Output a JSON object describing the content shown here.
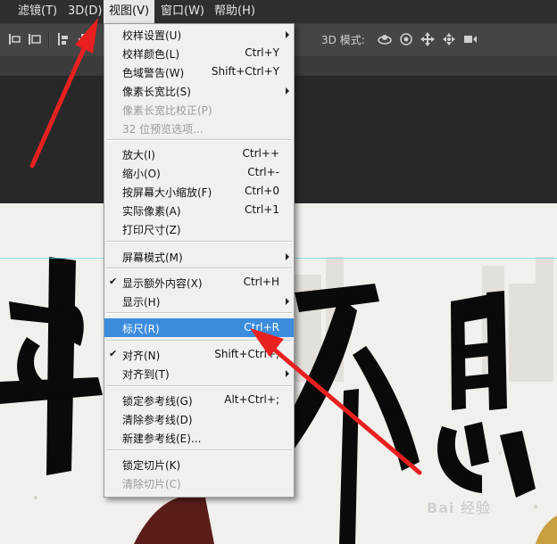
{
  "menubar": {
    "items": [
      {
        "label": "滤镜(T)"
      },
      {
        "label": "3D(D)"
      },
      {
        "label": "视图(V)"
      },
      {
        "label": "窗口(W)"
      },
      {
        "label": "帮助(H)"
      }
    ]
  },
  "toolbar": {
    "mode_3d_label": "3D 模式:",
    "icons": [
      "align-left-icon",
      "align-center-icon",
      "align-top-icon",
      "rotate-3d-icon",
      "roll-3d-icon",
      "pan-3d-icon",
      "slide-3d-icon",
      "scale-3d-icon"
    ]
  },
  "view_menu": {
    "items": [
      {
        "label": "校样设置(U)",
        "shortcut": "",
        "submenu": true,
        "disabled": false
      },
      {
        "label": "校样颜色(L)",
        "shortcut": "Ctrl+Y",
        "submenu": false,
        "disabled": false
      },
      {
        "label": "色域警告(W)",
        "shortcut": "Shift+Ctrl+Y",
        "submenu": false,
        "disabled": false
      },
      {
        "label": "像素长宽比(S)",
        "shortcut": "",
        "submenu": true,
        "disabled": false
      },
      {
        "label": "像素长宽比校正(P)",
        "shortcut": "",
        "submenu": false,
        "disabled": true
      },
      {
        "label": "32 位预览选项...",
        "shortcut": "",
        "submenu": false,
        "disabled": true
      },
      {
        "label": "放大(I)",
        "shortcut": "Ctrl++",
        "submenu": false,
        "disabled": false
      },
      {
        "label": "缩小(O)",
        "shortcut": "Ctrl+-",
        "submenu": false,
        "disabled": false
      },
      {
        "label": "按屏幕大小缩放(F)",
        "shortcut": "Ctrl+0",
        "submenu": false,
        "disabled": false
      },
      {
        "label": "实际像素(A)",
        "shortcut": "Ctrl+1",
        "submenu": false,
        "disabled": false
      },
      {
        "label": "打印尺寸(Z)",
        "shortcut": "",
        "submenu": false,
        "disabled": false
      },
      {
        "label": "屏幕模式(M)",
        "shortcut": "",
        "submenu": true,
        "disabled": false
      },
      {
        "label": "显示额外内容(X)",
        "shortcut": "Ctrl+H",
        "submenu": false,
        "disabled": false,
        "checked": true
      },
      {
        "label": "显示(H)",
        "shortcut": "",
        "submenu": true,
        "disabled": false
      },
      {
        "label": "标尺(R)",
        "shortcut": "Ctrl+R",
        "submenu": false,
        "disabled": false,
        "highlighted": true
      },
      {
        "label": "对齐(N)",
        "shortcut": "Shift+Ctrl+;",
        "submenu": false,
        "disabled": false,
        "checked": true
      },
      {
        "label": "对齐到(T)",
        "shortcut": "",
        "submenu": true,
        "disabled": false
      },
      {
        "label": "锁定参考线(G)",
        "shortcut": "Alt+Ctrl+;",
        "submenu": false,
        "disabled": false
      },
      {
        "label": "清除参考线(D)",
        "shortcut": "",
        "submenu": false,
        "disabled": false
      },
      {
        "label": "新建参考线(E)...",
        "shortcut": "",
        "submenu": false,
        "disabled": false
      },
      {
        "label": "锁定切片(K)",
        "shortcut": "",
        "submenu": false,
        "disabled": false
      },
      {
        "label": "清除切片(C)",
        "shortcut": "",
        "submenu": false,
        "disabled": true
      }
    ]
  },
  "canvas": {
    "watermark": "Bai 经验"
  },
  "colors": {
    "menu_highlight": "#3c8cde",
    "annotation_arrow": "#e8201f",
    "guide_line": "#5ce0e6"
  }
}
